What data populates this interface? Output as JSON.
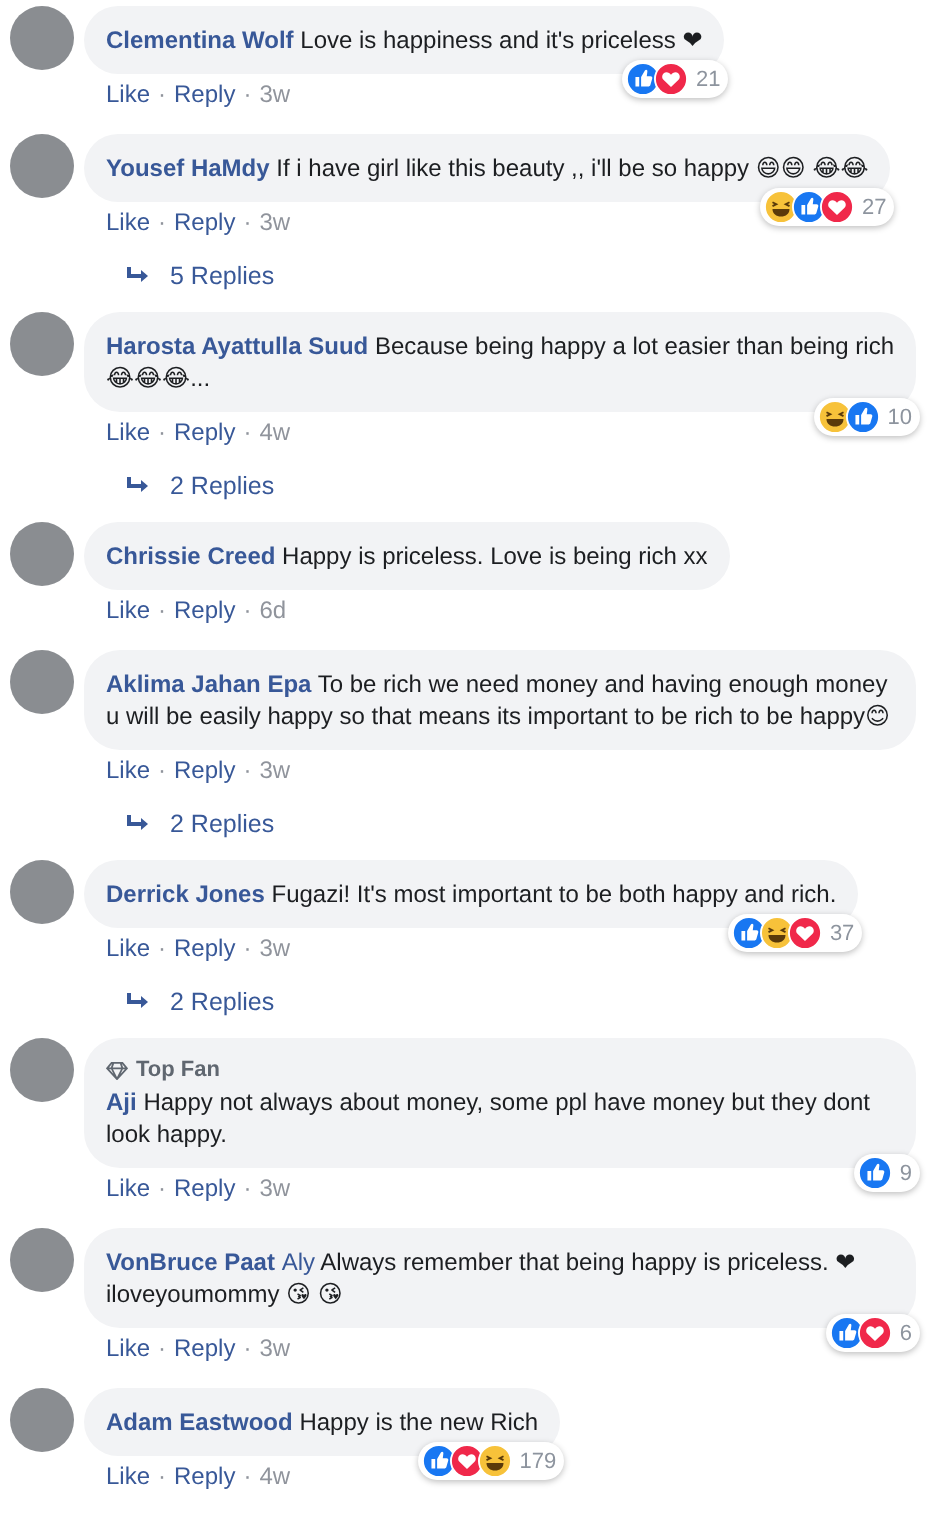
{
  "separator": "·",
  "comments": [
    {
      "author": "Clementina Wolf",
      "text": "Love is happiness and it's priceless ❤",
      "actions": [
        "Like",
        "Reply"
      ],
      "time": "3w",
      "reactions": [
        {
          "kind": "like"
        },
        {
          "kind": "love"
        }
      ],
      "reaction_count": "21"
    },
    {
      "author": "Yousef HaMdy",
      "text": "If i have girl like this beauty ,, i'll be so happy 😄😄 😂😂",
      "actions": [
        "Like",
        "Reply"
      ],
      "time": "3w",
      "reactions": [
        {
          "kind": "haha"
        },
        {
          "kind": "like"
        },
        {
          "kind": "love"
        }
      ],
      "reaction_count": "27",
      "replies": "5 Replies"
    },
    {
      "author": "Harosta Ayattulla Suud",
      "text": "Because being happy a lot easier than being rich 😂😂😂...",
      "actions": [
        "Like",
        "Reply"
      ],
      "time": "4w",
      "reactions": [
        {
          "kind": "haha"
        },
        {
          "kind": "like"
        }
      ],
      "reaction_count": "10",
      "replies": "2 Replies"
    },
    {
      "author": "Chrissie Creed",
      "text": "Happy is priceless. Love is being rich xx",
      "actions": [
        "Like",
        "Reply"
      ],
      "time": "6d"
    },
    {
      "author": "Aklima Jahan Epa",
      "text": "To be rich we need money and having enough money u will be easily happy so that means its important to be rich to be happy😊",
      "actions": [
        "Like",
        "Reply"
      ],
      "time": "3w",
      "replies": "2 Replies"
    },
    {
      "author": "Derrick Jones",
      "text": "Fugazi! It's most important to be both happy and rich.",
      "actions": [
        "Like",
        "Reply"
      ],
      "time": "3w",
      "reactions": [
        {
          "kind": "like"
        },
        {
          "kind": "haha"
        },
        {
          "kind": "love"
        }
      ],
      "reaction_count": "37",
      "replies": "2 Replies"
    },
    {
      "badge": "Top Fan",
      "author": "Aji",
      "text": "Happy not always about money, some ppl have money but they dont look happy.",
      "actions": [
        "Like",
        "Reply"
      ],
      "time": "3w",
      "reactions": [
        {
          "kind": "like"
        }
      ],
      "reaction_count": "9"
    },
    {
      "author": "VonBruce Paat",
      "mention": "Aly",
      "text": "Always remember that being happy is priceless. ❤ iloveyoumommy 😘 😘",
      "actions": [
        "Like",
        "Reply"
      ],
      "time": "3w",
      "reactions": [
        {
          "kind": "like"
        },
        {
          "kind": "love"
        }
      ],
      "reaction_count": "6"
    },
    {
      "author": "Adam Eastwood",
      "text": "Happy is the new Rich",
      "actions": [
        "Like",
        "Reply"
      ],
      "time": "4w",
      "reactions": [
        {
          "kind": "like"
        },
        {
          "kind": "love"
        },
        {
          "kind": "haha"
        }
      ],
      "reaction_count": "179"
    }
  ]
}
